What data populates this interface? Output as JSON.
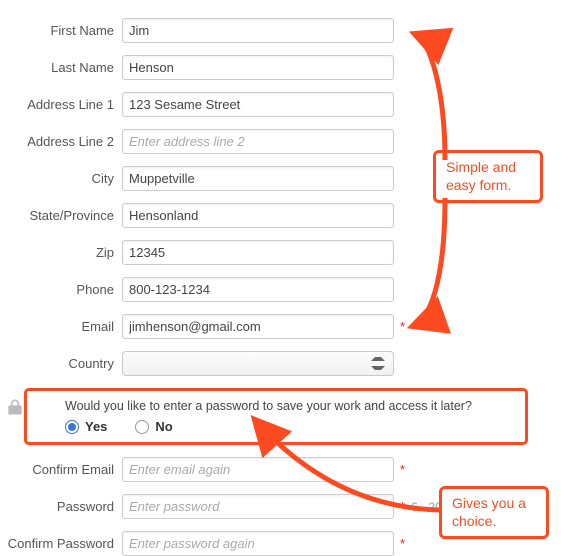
{
  "labels": {
    "first_name": "First Name",
    "last_name": "Last Name",
    "address1": "Address Line 1",
    "address2": "Address Line 2",
    "city": "City",
    "state": "State/Province",
    "zip": "Zip",
    "phone": "Phone",
    "email": "Email",
    "country": "Country",
    "confirm_email": "Confirm Email",
    "password": "Password",
    "confirm_password": "Confirm Password"
  },
  "values": {
    "first_name": "Jim",
    "last_name": "Henson",
    "address1": "123 Sesame Street",
    "address2": "",
    "city": "Muppetville",
    "state": "Hensonland",
    "zip": "12345",
    "phone": "800-123-1234",
    "email": "jimhenson@gmail.com",
    "country": "",
    "confirm_email": "",
    "password": "",
    "confirm_password": ""
  },
  "placeholders": {
    "address2": "Enter address line 2",
    "confirm_email": "Enter email again",
    "password": "Enter password",
    "confirm_password": "Enter password again"
  },
  "required_mark": "*",
  "password_hint": "6 - 20",
  "gate": {
    "question": "Would you like to enter a password to save your work and access it later?",
    "yes": "Yes",
    "no": "No",
    "selected": "yes"
  },
  "callouts": {
    "simple": "Simple and easy form.",
    "choice": "Gives you a choice."
  }
}
